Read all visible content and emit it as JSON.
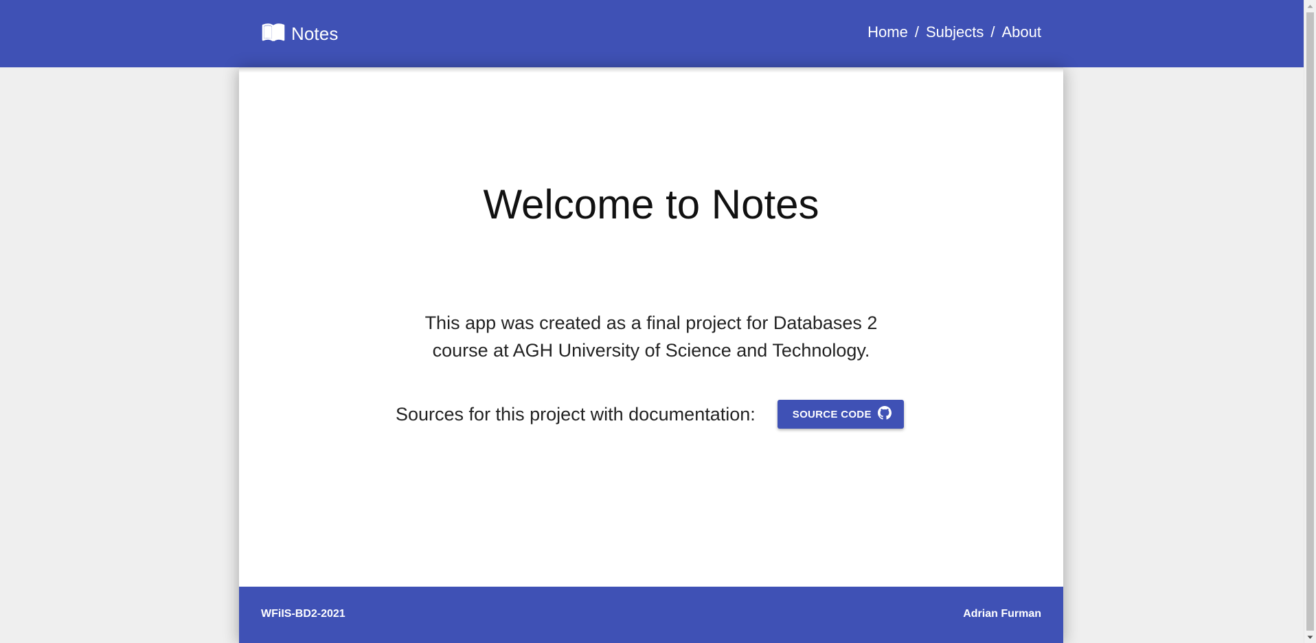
{
  "appbar": {
    "brand_icon": "open-book-icon",
    "title": "Notes",
    "nav": [
      {
        "label": "Home"
      },
      {
        "label": "Subjects"
      },
      {
        "label": "About"
      }
    ],
    "separator": "/",
    "color": "#3f51b5"
  },
  "main": {
    "heading": "Welcome to Notes",
    "description": "This app was created as a final project for Databases 2 course at AGH University of Science and Technology.",
    "sources_label": "Sources for this project with documentation:",
    "source_button": {
      "label": "SOURCE CODE",
      "icon": "github-icon"
    }
  },
  "footer": {
    "left": "WFiIS-BD2-2021",
    "right": "Adrian Furman"
  }
}
